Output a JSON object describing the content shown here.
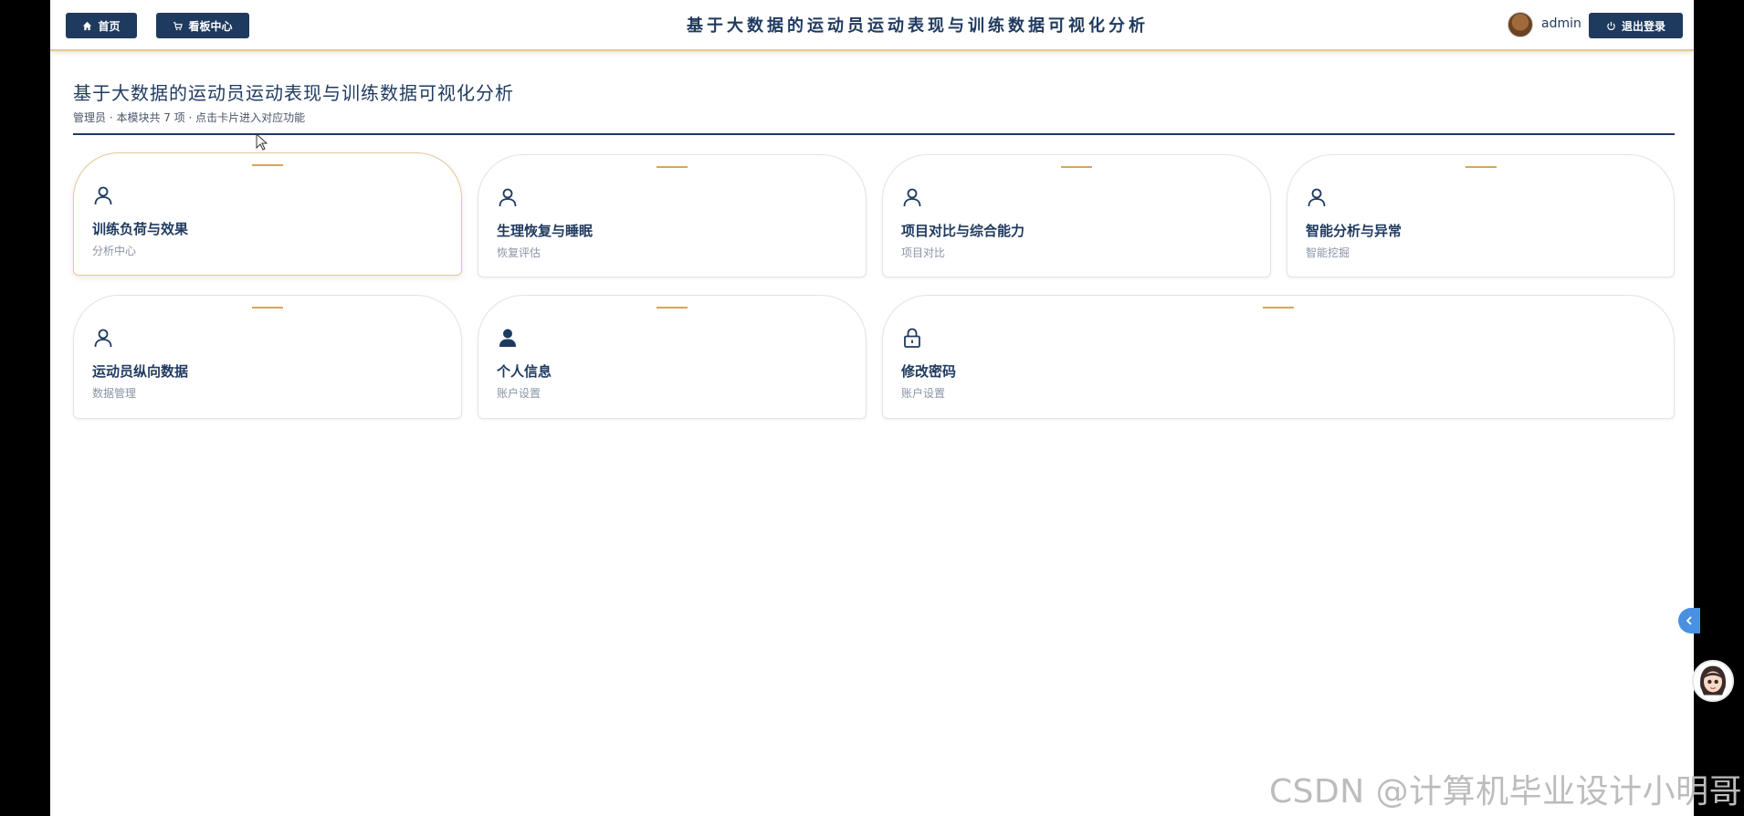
{
  "topbar": {
    "home_label": "首页",
    "dashboard_label": "看板中心",
    "title": "基于大数据的运动员运动表现与训练数据可视化分析",
    "username": "admin",
    "logout_label": "退出登录"
  },
  "header": {
    "title": "基于大数据的运动员运动表现与训练数据可视化分析",
    "subtitle": "管理员 · 本模块共 7 项 · 点击卡片进入对应功能"
  },
  "cards": [
    {
      "title": "训练负荷与效果",
      "desc": "分析中心",
      "icon": "user-outline-icon"
    },
    {
      "title": "生理恢复与睡眠",
      "desc": "恢复评估",
      "icon": "user-outline-icon"
    },
    {
      "title": "项目对比与综合能力",
      "desc": "项目对比",
      "icon": "user-outline-icon"
    },
    {
      "title": "智能分析与异常",
      "desc": "智能挖掘",
      "icon": "user-outline-icon"
    },
    {
      "title": "运动员纵向数据",
      "desc": "数据管理",
      "icon": "user-outline-icon"
    },
    {
      "title": "个人信息",
      "desc": "账户设置",
      "icon": "user-filled-icon"
    },
    {
      "title": "修改密码",
      "desc": "账户设置",
      "icon": "lock-icon"
    }
  ],
  "watermark": "CSDN @计算机毕业设计小明哥",
  "colors": {
    "primary": "#1f3a5f",
    "accent": "#d9a55a",
    "muted": "#8a94a6",
    "float_button": "#4a90e2"
  }
}
